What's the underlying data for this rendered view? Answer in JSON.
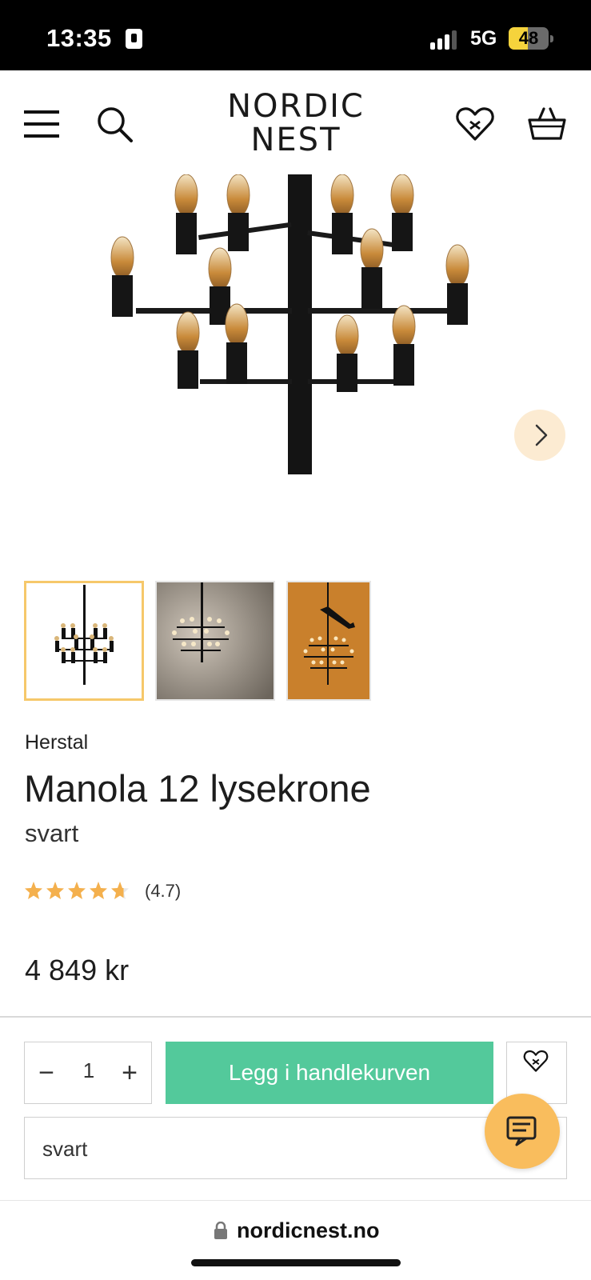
{
  "status_bar": {
    "time": "13:35",
    "network": "5G",
    "battery": "48",
    "battery_level": 0.48,
    "signal_bars": 3
  },
  "header": {
    "logo_line1": "NORDIC",
    "logo_line2": "NEST",
    "icons": [
      "menu-icon",
      "search-icon",
      "wishlist-heart-icon",
      "basket-icon"
    ]
  },
  "product": {
    "brand": "Herstal",
    "title": "Manola 12 lysekrone",
    "variant": "svart",
    "rating": 4.7,
    "rating_text": "(4.7)",
    "price": "4 849 kr",
    "thumbnails": [
      "thumbnail-1",
      "thumbnail-2",
      "thumbnail-3"
    ]
  },
  "purchase": {
    "minus": "−",
    "quantity": "1",
    "plus": "+",
    "add_to_cart": "Legg i handlekurven",
    "selected_variant": "svart"
  },
  "browser": {
    "url": "nordicnest.no"
  },
  "colors": {
    "accent_green": "#53c99b",
    "thumb_active": "#f6c86a",
    "chat_orange": "#f9bd5d",
    "star_color": "#f4b04d",
    "next_bg": "#fcebd2"
  }
}
